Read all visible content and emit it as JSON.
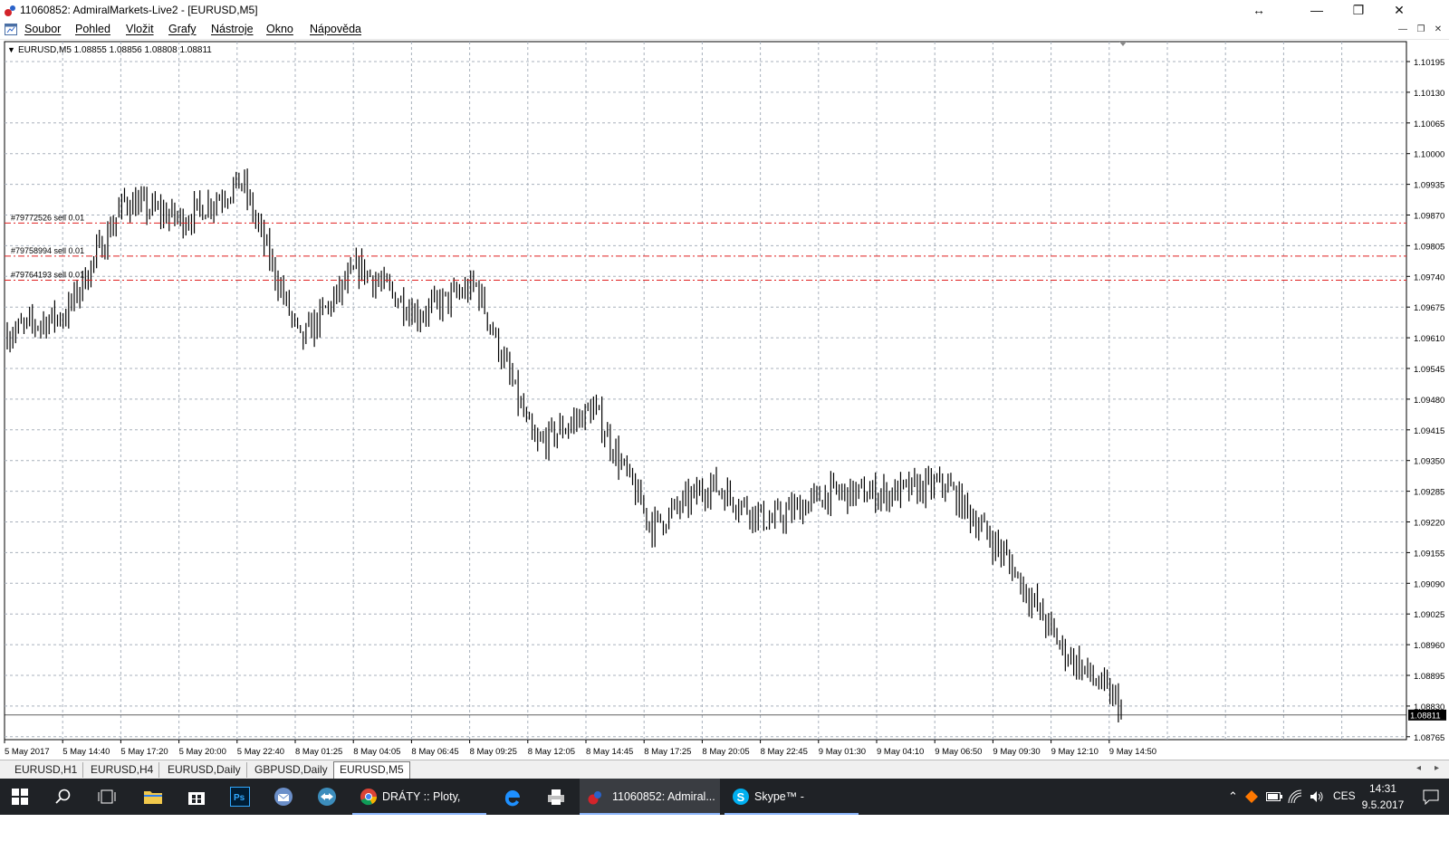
{
  "window": {
    "title": "11060852: AdmiralMarkets-Live2 - [EURUSD,M5]",
    "controls": [
      "↔",
      "—",
      "❐",
      "✕"
    ]
  },
  "menu": {
    "items": [
      "Soubor",
      "Pohled",
      "Vložit",
      "Grafy",
      "Nástroje",
      "Okno",
      "Nápověda"
    ]
  },
  "chart": {
    "header": "EURUSD,M5  1.08855 1.08856 1.08808 1.08811",
    "current_price": "1.08811",
    "y_ticks": [
      "1.10195",
      "1.10130",
      "1.10065",
      "1.10000",
      "1.09935",
      "1.09870",
      "1.09805",
      "1.09740",
      "1.09675",
      "1.09610",
      "1.09545",
      "1.09480",
      "1.09415",
      "1.09350",
      "1.09285",
      "1.09220",
      "1.09155",
      "1.09090",
      "1.09025",
      "1.08960",
      "1.08895",
      "1.08830",
      "1.08765"
    ],
    "x_ticks": [
      "5 May 2017",
      "5 May 14:40",
      "5 May 17:20",
      "5 May 20:00",
      "5 May 22:40",
      "8 May 01:25",
      "8 May 04:05",
      "8 May 06:45",
      "8 May 09:25",
      "8 May 12:05",
      "8 May 14:45",
      "8 May 17:25",
      "8 May 20:05",
      "8 May 22:45",
      "9 May 01:30",
      "9 May 04:10",
      "9 May 06:50",
      "9 May 09:30",
      "9 May 12:10",
      "9 May 14:50"
    ],
    "orders": [
      {
        "label": "#79772526 sell 0.01",
        "price": 1.09853
      },
      {
        "label": "#79758994 sell 0.01",
        "price": 1.09783
      },
      {
        "label": "#79764193 sell 0.01",
        "price": 1.09732
      }
    ],
    "colors": {
      "grid": "#a8b0bc",
      "bars": "#000000",
      "order_line": "#e02020",
      "price_box": "#000000"
    }
  },
  "chart_data": {
    "type": "line",
    "symbol": "EURUSD",
    "timeframe": "M5",
    "title": "EURUSD,M5",
    "last_bar": {
      "open": 1.08855,
      "high": 1.08856,
      "low": 1.08808,
      "close": 1.08811
    },
    "ylim": [
      1.08765,
      1.10195
    ],
    "x": [
      "5 May 2017",
      "5 May 14:40",
      "5 May 17:20",
      "5 May 20:00",
      "5 May 22:40",
      "8 May 01:25",
      "8 May 04:05",
      "8 May 06:45",
      "8 May 09:25",
      "8 May 12:05",
      "8 May 14:45",
      "8 May 17:25",
      "8 May 20:05",
      "8 May 22:45",
      "9 May 01:30",
      "9 May 04:10",
      "9 May 06:50",
      "9 May 09:30",
      "9 May 12:10",
      "9 May 14:50"
    ],
    "series": [
      {
        "values": [
          1.0962,
          1.0966,
          1.099,
          1.0986,
          1.0994,
          1.096,
          1.0976,
          1.0966,
          1.0972,
          1.0938,
          1.0946,
          1.0921,
          1.093,
          1.0922,
          1.0928,
          1.0928,
          1.093,
          1.0915,
          1.0895,
          1.0883
        ]
      }
    ],
    "grid": true
  },
  "tabs": {
    "items": [
      "EURUSD,H1",
      "EURUSD,H4",
      "EURUSD,Daily",
      "GBPUSD,Daily",
      "EURUSD,M5"
    ],
    "active": 4
  },
  "taskbar": {
    "tasks": [
      {
        "label": "DRÁTY :: Ploty, gab..."
      },
      {
        "label": "11060852: Admiral..."
      },
      {
        "label": "Skype™ - martin.cr..."
      }
    ],
    "language": "CES",
    "time": "14:31",
    "date": "9.5.2017"
  }
}
